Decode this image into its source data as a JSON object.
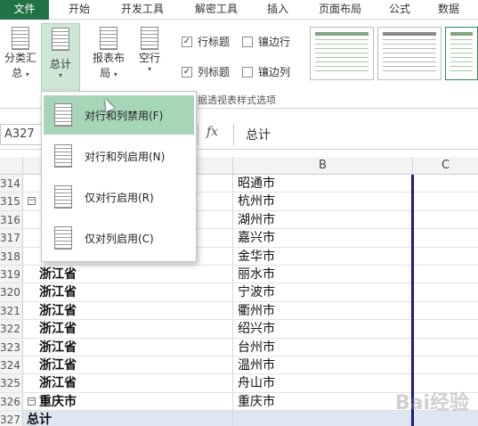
{
  "tabs": [
    "文件",
    "开始",
    "开发工具",
    "解密工具",
    "插入",
    "页面布局",
    "公式",
    "数据"
  ],
  "ribbon": {
    "subtotal_label": "分类汇总",
    "subtotal_line1": "分类汇",
    "subtotal_line2": "总",
    "grandtotal_label": "总计",
    "report_layout_line1": "报表布",
    "report_layout_line2": "局",
    "blank_rows_label": "空行",
    "checkbox_row_headers": "行标题",
    "checkbox_col_headers": "列标题",
    "checkbox_banded_rows": "镶边行",
    "checkbox_banded_cols": "镶边列",
    "group_label": "数据透视表样式选项",
    "group_label_visible": "据透视表样式选项",
    "caret": "▾",
    "check": "✓"
  },
  "dropdown": {
    "items": [
      {
        "label": "对行和列禁用(F)"
      },
      {
        "label": "对行和列启用(N)"
      },
      {
        "label": "仅对行启用(R)"
      },
      {
        "label": "仅对列启用(C)"
      }
    ]
  },
  "formula_bar": {
    "name_box": "A327",
    "fx": "fx",
    "value": "总计"
  },
  "columns": [
    "B",
    "C"
  ],
  "rows": [
    {
      "num": "314",
      "a": "",
      "b": "昭通市"
    },
    {
      "num": "315",
      "a": "",
      "b": "杭州市",
      "collapse": true
    },
    {
      "num": "316",
      "a": "",
      "b": "湖州市"
    },
    {
      "num": "317",
      "a": "",
      "b": "嘉兴市"
    },
    {
      "num": "318",
      "a": "",
      "b": "金华市"
    },
    {
      "num": "319",
      "a": "浙江省",
      "b": "丽水市"
    },
    {
      "num": "320",
      "a": "浙江省",
      "b": "宁波市"
    },
    {
      "num": "321",
      "a": "浙江省",
      "b": "衢州市"
    },
    {
      "num": "322",
      "a": "浙江省",
      "b": "绍兴市"
    },
    {
      "num": "323",
      "a": "浙江省",
      "b": "台州市"
    },
    {
      "num": "324",
      "a": "浙江省",
      "b": "温州市"
    },
    {
      "num": "325",
      "a": "浙江省",
      "b": "舟山市"
    },
    {
      "num": "326",
      "a": "重庆市",
      "b": "重庆市",
      "collapse": true
    },
    {
      "num": "327",
      "a": "总计",
      "b": "",
      "total": true
    }
  ],
  "watermark": "Bai经验"
}
